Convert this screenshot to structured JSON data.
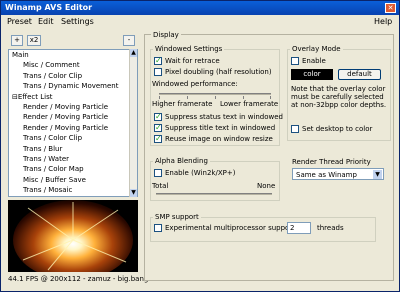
{
  "window": {
    "title": "Winamp AVS Editor",
    "close": "✕"
  },
  "menu": {
    "preset": "Preset",
    "edit": "Edit",
    "settings": "Settings",
    "help": "Help"
  },
  "toolbar": {
    "add": "+",
    "x2": "x2",
    "remove": "-"
  },
  "tree": [
    {
      "label": "Main",
      "indent": 0
    },
    {
      "label": "Misc / Comment",
      "indent": 1
    },
    {
      "label": "Trans / Color Clip",
      "indent": 1
    },
    {
      "label": "Trans / Dynamic Movement",
      "indent": 1
    },
    {
      "label": "Effect List",
      "indent": 0,
      "expander": "⊟"
    },
    {
      "label": "Render / Moving Particle",
      "indent": 1
    },
    {
      "label": "Render / Moving Particle",
      "indent": 1
    },
    {
      "label": "Render / Moving Particle",
      "indent": 1
    },
    {
      "label": "Trans / Color Clip",
      "indent": 1
    },
    {
      "label": "Trans / Blur",
      "indent": 1
    },
    {
      "label": "Trans / Water",
      "indent": 1
    },
    {
      "label": "Trans / Color Map",
      "indent": 1
    },
    {
      "label": "Misc / Buffer Save",
      "indent": 1
    },
    {
      "label": "Trans / Mosaic",
      "indent": 1
    }
  ],
  "status": "44.1 FPS @ 200x112 - zamuz - big.bang",
  "display": {
    "title": "Display",
    "windowed": {
      "title": "Windowed Settings",
      "wait_retrace": "Wait for retrace",
      "pixel_doubling": "Pixel doubling (half resolution)",
      "performance": "Windowed performance:",
      "higher": "Higher framerate",
      "lower": "Lower framerate",
      "suppress_status": "Suppress status text in windowed",
      "suppress_title": "Suppress title text in windowed",
      "reuse_image": "Reuse image on window resize"
    },
    "alpha": {
      "title": "Alpha Blending",
      "enable": "Enable (Win2k/XP+)",
      "total": "Total",
      "none": "None"
    },
    "smp": {
      "title": "SMP support",
      "experimental": "Experimental multiprocessor support:",
      "threads_value": "2",
      "threads": "threads"
    },
    "overlay": {
      "title": "Overlay Mode",
      "enable": "Enable",
      "color": "color",
      "default": "default",
      "note": "Note that the overlay color must be carefully selected at non-32bpp color depths.",
      "set_desktop": "Set desktop to color"
    },
    "render_thread": {
      "title": "Render Thread Priority",
      "value": "Same as Winamp"
    }
  }
}
